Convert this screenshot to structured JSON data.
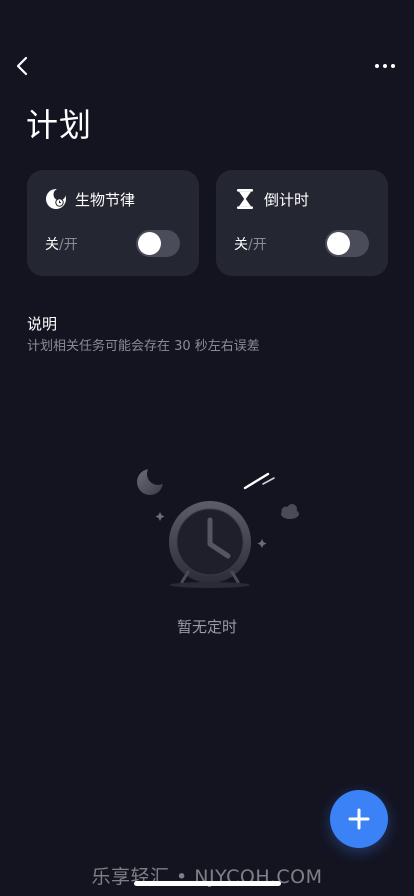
{
  "header": {
    "back_icon": "chevron-left-icon",
    "more_icon": "more-horizontal-icon"
  },
  "page": {
    "title": "计划"
  },
  "cards": [
    {
      "icon": "moon-clock-icon",
      "title": "生物节律",
      "state_on": "关",
      "state_sep": "/",
      "state_off": "开",
      "toggle_on": false
    },
    {
      "icon": "hourglass-icon",
      "title": "倒计时",
      "state_on": "关",
      "state_sep": "/",
      "state_off": "开",
      "toggle_on": false
    }
  ],
  "note": {
    "title": "说明",
    "body": "计划相关任务可能会存在 30 秒左右误差"
  },
  "empty_state": {
    "illustration": "alarm-clock-night-icon",
    "text": "暂无定时"
  },
  "fab": {
    "icon": "plus-icon"
  },
  "watermark": "乐享轻汇 • NJYCQH.COM",
  "colors": {
    "background": "#141421",
    "card": "#242632",
    "accent": "#3b82f6",
    "muted_text": "#8a8b96"
  }
}
